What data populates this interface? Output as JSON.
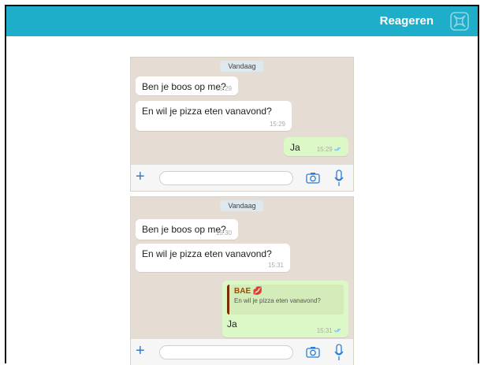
{
  "header": {
    "title": "Reageren",
    "logo_icon": "knot-logo-icon",
    "background_color": "#1eaec9"
  },
  "chats": [
    {
      "date_label": "Vandaag",
      "messages": [
        {
          "text": "Ben je boos op me?",
          "time": "15:29",
          "direction": "in"
        },
        {
          "text": "En wil je pizza eten vanavond?",
          "time": "15:29",
          "direction": "in"
        },
        {
          "text": "Ja",
          "time": "15:29",
          "direction": "out",
          "ticks": "double-check-icon"
        }
      ],
      "input": {
        "placeholder": ""
      }
    },
    {
      "date_label": "Vandaag",
      "messages": [
        {
          "text": "Ben je boos op me?",
          "time": "15:30",
          "direction": "in"
        },
        {
          "text": "En wil je pizza eten vanavond?",
          "time": "15:31",
          "direction": "in"
        },
        {
          "direction": "out",
          "reply_to": {
            "author": "BAE",
            "author_icon": "kiss-lips-icon",
            "text": "En wil je pizza eten vanavond?"
          },
          "text": "Ja",
          "time": "15:31",
          "ticks": "double-check-icon"
        }
      ],
      "input": {
        "placeholder": ""
      }
    }
  ]
}
